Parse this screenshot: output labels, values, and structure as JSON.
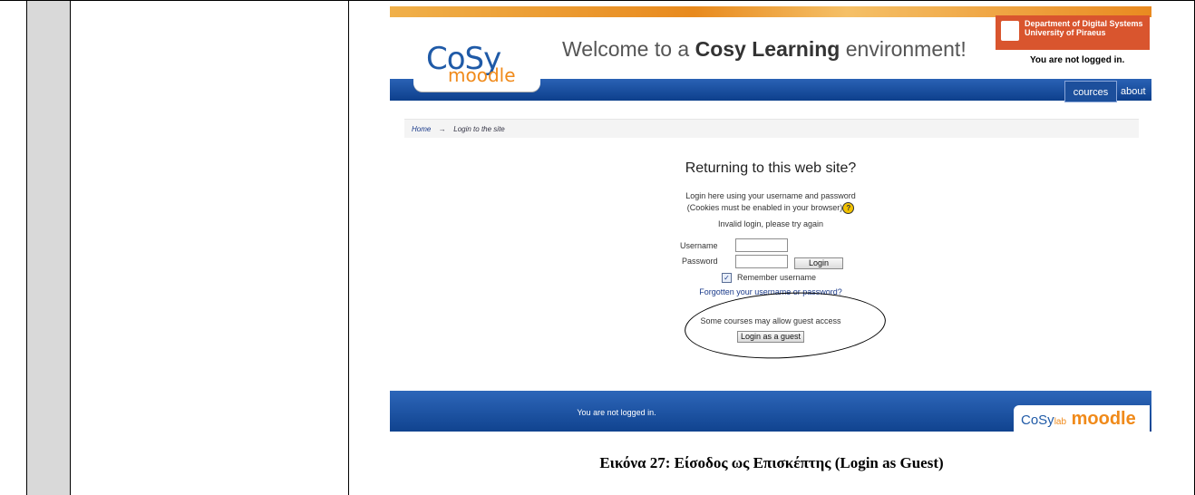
{
  "moodle": {
    "logo_cosy": "CoSy",
    "logo_moodle": "moodle",
    "welcome_prefix": "Welcome to a ",
    "welcome_bold": "Cosy Learning",
    "welcome_suffix": " environment!",
    "dept_line1": "Department of Digital Systems",
    "dept_line2": "University of Piraeus",
    "not_logged_in_top": "You are not logged in.",
    "nav": {
      "courses": "cources",
      "about": "about"
    },
    "breadcrumb": {
      "home": "Home",
      "arrow": "→",
      "current": "Login to the site"
    },
    "login": {
      "title": "Returning to this web site?",
      "line1": "Login here using your username and password",
      "line2": "(Cookies must be enabled in your browser)",
      "help_glyph": "?",
      "error": "Invalid login, please try again",
      "username_label": "Username",
      "password_label": "Password",
      "username_value": "",
      "password_value": "",
      "login_button": "Login",
      "remember_checked": true,
      "remember_label": "Remember username",
      "forgot_link": "Forgotten your username or password?",
      "guest_text": "Some courses may allow guest access",
      "guest_button": "Login as a guest"
    },
    "footer": {
      "not_logged_in": "You are not logged in.",
      "logo_text": "CoSy Lab moodle"
    }
  },
  "caption": "Εικόνα 27: Είσοδος ως Επισκέπτης (Login as Guest)",
  "colors": {
    "brand_blue": "#10438f",
    "brand_orange": "#f08a1a",
    "dept_red": "#d9552e"
  }
}
